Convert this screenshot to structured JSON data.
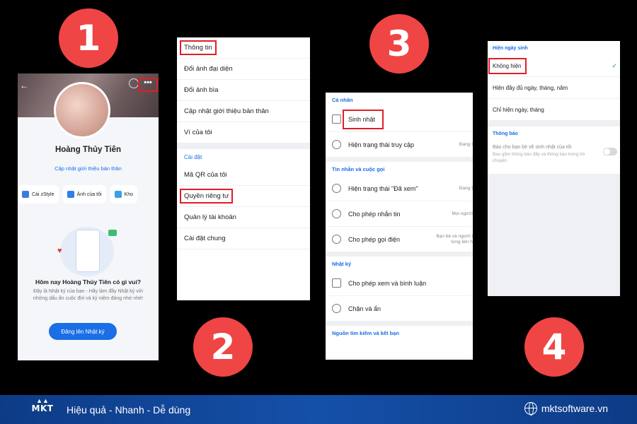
{
  "steps": [
    "1",
    "2",
    "3",
    "4"
  ],
  "phone1": {
    "more_icon": "•••",
    "back_icon": "←",
    "name": "Hoàng Thủy Tiên",
    "update_intro": "Cập nhật giới thiệu bản thân",
    "chips": [
      "Cài zStyle",
      "Ảnh của tôi",
      "Kho"
    ],
    "question": "Hôm nay Hoàng Thủy Tiên có gì vui?",
    "description": "Đây là Nhật ký của bạn - Hãy làm đầy Nhật ký với những dấu ấn cuộc đời và kỷ niệm đáng nhớ nhé!",
    "post_button": "Đăng lên Nhật ký"
  },
  "phone2": {
    "items_top": [
      "Thông tin",
      "Đổi ảnh đại diện",
      "Đổi ảnh bìa",
      "Cập nhật giới thiệu bản thân",
      "Ví của tôi"
    ],
    "settings_header": "Cài đặt",
    "items_bottom": [
      "Mã QR của tôi",
      "Quyền riêng tư",
      "Quản lý tài khoản",
      "Cài đặt chung"
    ]
  },
  "phone3": {
    "personal_header": "Cá nhân",
    "birthday": "Sinh nhật",
    "access_status": "Hiện trạng thái truy cập",
    "access_status_value": "Đang t",
    "messages_header": "Tin nhắn và cuộc gọi",
    "seen_status": "Hiện trạng thái \"Đã xem\"",
    "seen_status_value": "Đang t",
    "allow_messages": "Cho phép nhắn tin",
    "allow_messages_value": "Mọi người",
    "allow_calls": "Cho phép gọi điện",
    "allow_calls_value_1": "Bạn bè và người l",
    "allow_calls_value_2": "từng liên h",
    "diary_header": "Nhật ký",
    "allow_comments": "Cho phép xem và bình luận",
    "block_hide": "Chặn và ẩn",
    "search_header": "Nguồn tìm kiếm và kết bạn"
  },
  "phone4": {
    "birthday_header": "Hiện ngày sinh",
    "options": [
      "Không hiện",
      "Hiện đầy đủ ngày, tháng, năm",
      "Chỉ hiện ngày, tháng"
    ],
    "check_icon": "✓",
    "notif_header": "Thông báo",
    "notif_title": "Báo cho bạn bè về sinh nhật của tôi",
    "notif_sub": "Bao gồm thông báo đẩy và thông báo trong trò chuyện"
  },
  "footer": {
    "logo_text": "MKT",
    "slogan": "Hiệu quả - Nhanh - Dễ dùng",
    "website": "mktsoftware.vn"
  },
  "colors": {
    "step_badge": "#ef4545",
    "highlight": "#e11d2a",
    "accent_blue": "#1a6ee6",
    "footer_bg": "#1450a8"
  }
}
